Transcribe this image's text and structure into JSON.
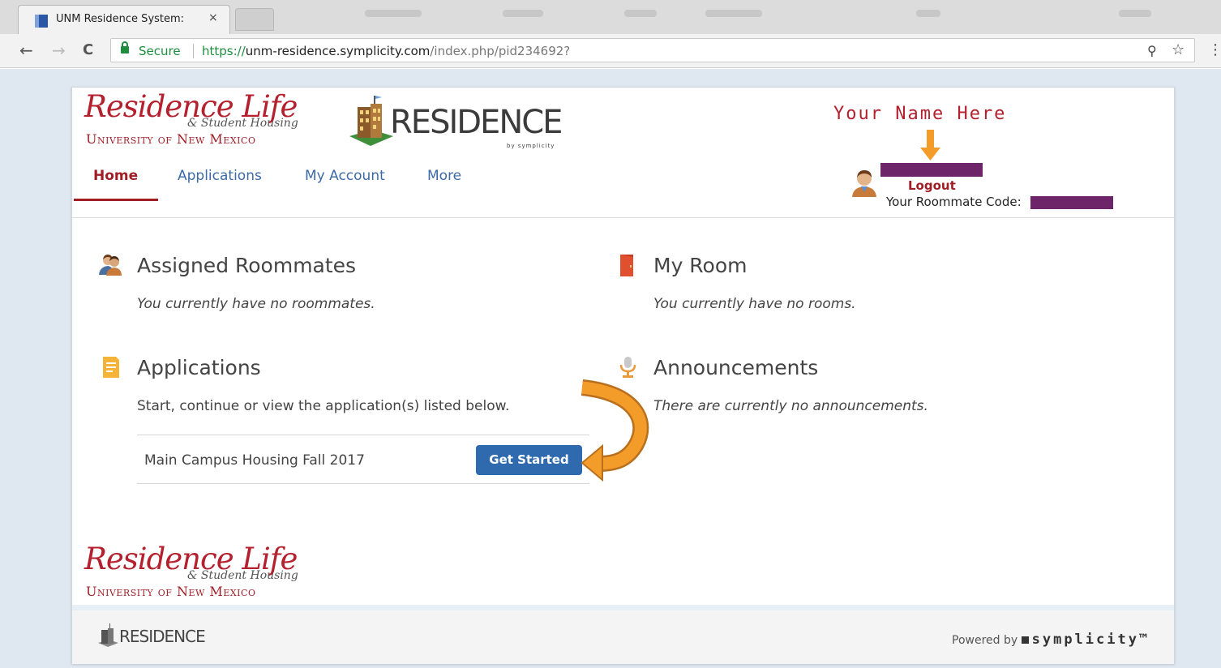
{
  "browser": {
    "tab_title": "UNM Residence System:",
    "tab_close": "×",
    "back": "←",
    "forward": "→",
    "reload": "C",
    "secure_label": "Secure",
    "url_scheme": "https://",
    "url_host": "unm-residence.symplicity.com",
    "url_path": "/index.php/pid234692?",
    "key_icon_glyph": "⚲",
    "star_icon_glyph": "☆",
    "menu_glyph": "⋮"
  },
  "header": {
    "logo_main": "Residence Life",
    "logo_sub": "& Student Housing",
    "logo_university": "University of New Mexico",
    "residence_logo": "RESIDENCE",
    "residence_by": "by symplicity",
    "annotation_name": "Your Name Here"
  },
  "nav": {
    "tabs": [
      {
        "label": "Home",
        "active": true
      },
      {
        "label": "Applications",
        "active": false
      },
      {
        "label": "My Account",
        "active": false
      },
      {
        "label": "More",
        "active": false
      }
    ]
  },
  "user": {
    "logout": "Logout",
    "roommate_code_label": "Your Roommate Code:"
  },
  "sections": {
    "roommates": {
      "title": "Assigned Roommates",
      "message": "You currently have no roommates.",
      "icon": "roommates-icon"
    },
    "room": {
      "title": "My Room",
      "message": "You currently have no rooms.",
      "icon": "door-icon"
    },
    "applications": {
      "title": "Applications",
      "intro": "Start, continue or view the application(s) listed below.",
      "icon": "document-icon",
      "items": [
        {
          "name": "Main Campus Housing Fall 2017",
          "action": "Get Started"
        }
      ]
    },
    "announcements": {
      "title": "Announcements",
      "message": "There are currently no announcements.",
      "icon": "microphone-icon"
    }
  },
  "footer": {
    "residence": "RESIDENCE",
    "powered_by": "Powered by",
    "symplicity": "symplicity™"
  },
  "colors": {
    "brand_red": "#a01d26",
    "link_blue": "#3d6aa6",
    "button_blue": "#2e6aad",
    "redaction": "#6e2468",
    "annotation_orange": "#f39c2a"
  }
}
